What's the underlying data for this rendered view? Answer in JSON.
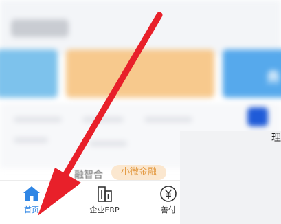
{
  "background": {
    "card_right_text": "务",
    "right_label": "理",
    "strip_text": "融智合",
    "strip_badge": "小微金融"
  },
  "tabbar": {
    "items": [
      {
        "label": "首页",
        "icon": "home-icon",
        "active": true,
        "color": "#2f86e5"
      },
      {
        "label": "企业ERP",
        "icon": "building-icon",
        "active": false
      },
      {
        "label": "善付",
        "icon": "yuan-coin-icon",
        "active": false
      }
    ]
  },
  "annotation": {
    "arrow_color": "#e8202a",
    "icon": "red-arrow-pointer"
  }
}
